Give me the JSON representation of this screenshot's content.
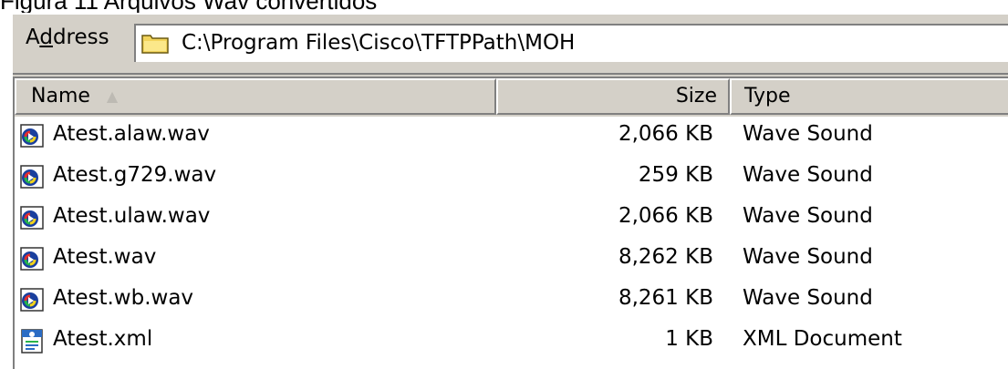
{
  "caption": "Figura 11 Arquivos Wav convertidos",
  "address": {
    "label_prefix": "A",
    "label_underlined": "d",
    "label_suffix": "dress",
    "path": "C:\\Program Files\\Cisco\\TFTPPath\\MOH",
    "icon": "folder-icon"
  },
  "columns": {
    "name": "Name",
    "size": "Size",
    "type": "Type",
    "sort_indicator": "▲"
  },
  "files": [
    {
      "name": "Atest.alaw.wav",
      "size": "2,066 KB",
      "type": "Wave Sound",
      "icon": "wave-sound-icon"
    },
    {
      "name": "Atest.g729.wav",
      "size": "259 KB",
      "type": "Wave Sound",
      "icon": "wave-sound-icon"
    },
    {
      "name": "Atest.ulaw.wav",
      "size": "2,066 KB",
      "type": "Wave Sound",
      "icon": "wave-sound-icon"
    },
    {
      "name": "Atest.wav",
      "size": "8,262 KB",
      "type": "Wave Sound",
      "icon": "wave-sound-icon"
    },
    {
      "name": "Atest.wb.wav",
      "size": "8,261 KB",
      "type": "Wave Sound",
      "icon": "wave-sound-icon"
    },
    {
      "name": "Atest.xml",
      "size": "1 KB",
      "type": "XML Document",
      "icon": "xml-document-icon"
    }
  ]
}
